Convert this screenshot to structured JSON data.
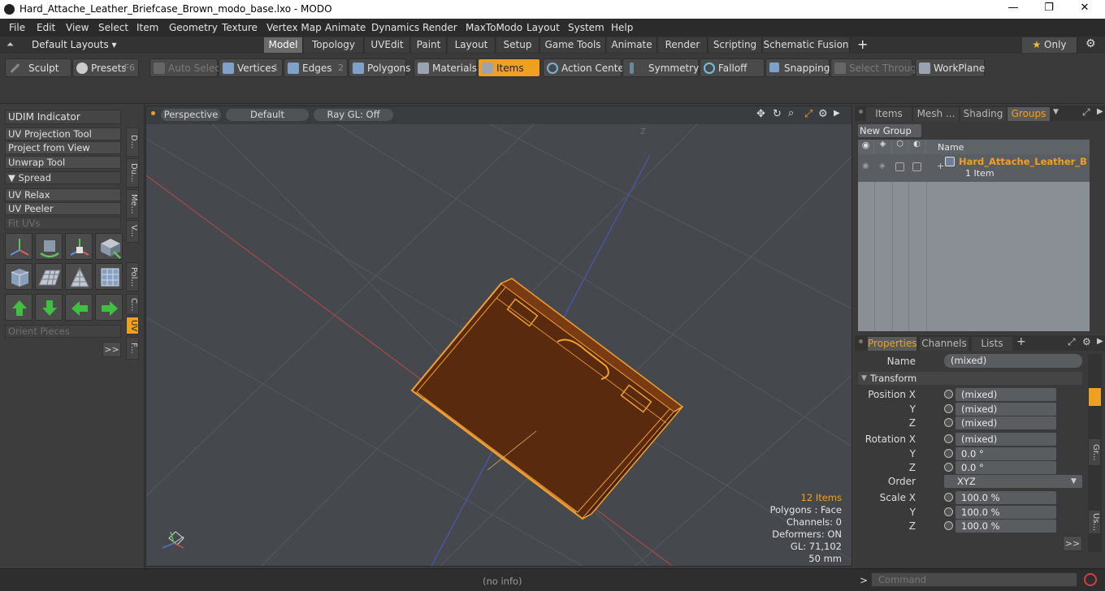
{
  "window": {
    "title": "Hard_Attache_Leather_Briefcase_Brown_modo_base.lxo - MODO",
    "minimize": "—",
    "maximize": "❐",
    "close": "✕"
  },
  "menu": [
    "File",
    "Edit",
    "View",
    "Select",
    "Item",
    "Geometry",
    "Texture",
    "Vertex Map",
    "Animate",
    "Dynamics",
    "Render",
    "MaxToModo",
    "Layout",
    "System",
    "Help"
  ],
  "layouts": {
    "selector": "Default Layouts ▾",
    "tabs": [
      "Model",
      "Topology",
      "UVEdit",
      "Paint",
      "Layout",
      "Setup",
      "Game Tools",
      "Animate",
      "Render",
      "Scripting",
      "Schematic Fusion"
    ],
    "add": "+",
    "only": "Only",
    "star": "★"
  },
  "toolbar": {
    "sculpt": "Sculpt",
    "presets": "Presets",
    "presets_key": "F6",
    "auto_select": "Auto Select",
    "vertices": "Vertices",
    "vertices_num": "1",
    "edges": "Edges",
    "edges_num": "2",
    "polygons": "Polygons",
    "materials": "Materials",
    "items": "Items",
    "action_center": "Action Center",
    "symmetry": "Symmetry",
    "falloff": "Falloff",
    "snapping": "Snapping",
    "select_through": "Select Through",
    "workplane": "WorkPlane"
  },
  "left_panel": {
    "items": [
      {
        "label": "UDIM Indicator",
        "dim": false
      },
      {
        "label": "UV Projection Tool",
        "dim": false
      },
      {
        "label": "Project from View",
        "dim": false
      },
      {
        "label": "Unwrap Tool",
        "dim": false
      },
      {
        "label": "▼ Spread",
        "dim": false
      },
      {
        "label": "UV Relax",
        "dim": false
      },
      {
        "label": "UV Peeler",
        "dim": false
      },
      {
        "label": "Fit UVs",
        "dim": true
      }
    ],
    "orient": "Orient Pieces",
    "more": ">>",
    "vtabs": [
      "D...",
      "Du...",
      "Me...",
      "V...",
      "Pol...",
      "C...",
      "UV",
      "F..."
    ]
  },
  "viewport": {
    "view": "Perspective",
    "shading": "Default",
    "raygl": "Ray GL: Off",
    "hud": {
      "items": "12 Items",
      "polygons": "Polygons : Face",
      "channels": "Channels: 0",
      "deformers": "Deformers: ON",
      "gl": "GL: 71,102",
      "units": "50 mm"
    },
    "axis_label": "Z"
  },
  "right_upper": {
    "tabs": [
      "Items",
      "Mesh ...",
      "Shading",
      "Groups"
    ],
    "new_group": "New Group",
    "col_name": "Name",
    "group_name": "Hard_Attache_Leather_B ...",
    "group_sub": "1 Item"
  },
  "properties": {
    "tabs": [
      "Properties",
      "Channels",
      "Lists"
    ],
    "name_label": "Name",
    "name_value": "(mixed)",
    "transform": "Transform",
    "rows": [
      {
        "label": "Position X",
        "value": "(mixed)"
      },
      {
        "label": "Y",
        "value": "(mixed)"
      },
      {
        "label": "Z",
        "value": "(mixed)"
      },
      {
        "label": "Rotation X",
        "value": "(mixed)"
      },
      {
        "label": "Y",
        "value": "0.0 °"
      },
      {
        "label": "Z",
        "value": "0.0 °"
      },
      {
        "label": "Order",
        "value": "XYZ"
      },
      {
        "label": "Scale X",
        "value": "100.0 %"
      },
      {
        "label": "Y",
        "value": "100.0 %"
      },
      {
        "label": "Z",
        "value": "100.0 %"
      }
    ],
    "more": ">>",
    "side_tabs": [
      "Gr...",
      "Us..."
    ]
  },
  "status": {
    "info": "(no info)",
    "command_placeholder": "Command",
    "prompt": ">"
  },
  "colors": {
    "accent": "#f0a020",
    "mesh": "#f2a030"
  }
}
